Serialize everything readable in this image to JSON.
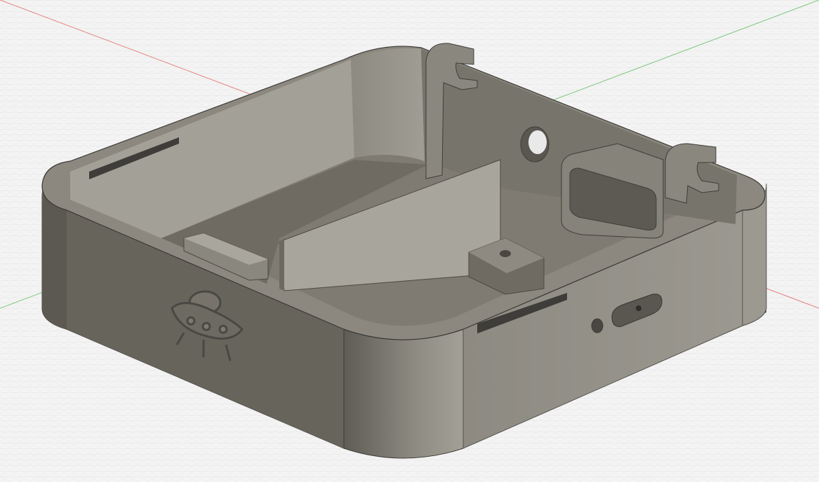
{
  "viewport": {
    "background": "#f4f4f4",
    "grid": "on",
    "grid_minor_color": "#dedede",
    "grid_major_color": "#c9c9c9",
    "axis_x_color": "#e06060",
    "axis_y_color": "#6fc26f"
  },
  "model": {
    "body_color": "#6e6a62",
    "body_shadow_color": "#5b5851",
    "inner_wall_color": "#9a988f",
    "floor_color": "#7f7b72",
    "rim_color": "#8c887f",
    "edge_color": "#3a3935",
    "emblem_icon": "ufo-emblem-icon"
  }
}
